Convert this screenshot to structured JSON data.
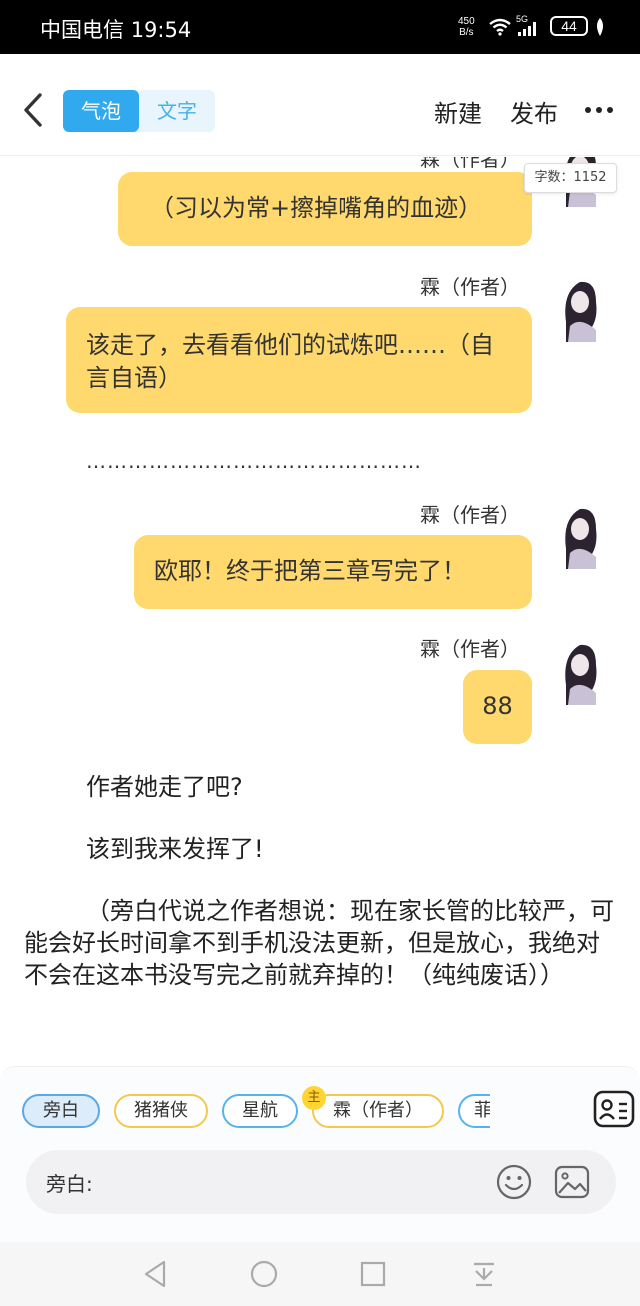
{
  "status": {
    "carrier": "中国电信",
    "time": "19:54",
    "net_speed_value": "450",
    "net_speed_unit": "B/s",
    "network": "5G",
    "battery": "44"
  },
  "header": {
    "mode_bubble": "气泡",
    "mode_text": "文字",
    "new_label": "新建",
    "publish_label": "发布"
  },
  "editor": {
    "word_count": "字数：1152"
  },
  "messages": [
    {
      "author": "霖（作者）",
      "text": "（习以为常+擦掉嘴角的血迹）"
    },
    {
      "author": "霖（作者）",
      "text": "该走了，去看看他们的试炼吧……（自言自语）"
    },
    {
      "author": "霖（作者）",
      "text": "欧耶！终于把第三章写完了！"
    },
    {
      "author": "霖（作者）",
      "text": "88"
    }
  ],
  "separator": "…………………………………………",
  "narration": [
    "作者她走了吧?",
    "该到我来发挥了!",
    "（旁白代说之作者想说：现在家长管的比较严，可能会好长时间拿不到手机没法更新，但是放心，我绝对不会在这本书没写完之前就弃掉的！（纯纯废话））"
  ],
  "characters": [
    {
      "label": "旁白"
    },
    {
      "label": "猪猪侠"
    },
    {
      "label": "星航"
    },
    {
      "label": "霖（作者）"
    },
    {
      "label": "菲"
    }
  ],
  "main_badge": "主",
  "input": {
    "label": "旁白:",
    "placeholder": ""
  },
  "icons": {
    "back": "chevron-left-icon",
    "more": "more-dots-icon",
    "role": "contact-card-icon",
    "emoji": "smiley-icon",
    "image": "image-icon"
  },
  "colors": {
    "accent_blue": "#30a9ee",
    "bubble_yellow": "#ffd96e"
  }
}
